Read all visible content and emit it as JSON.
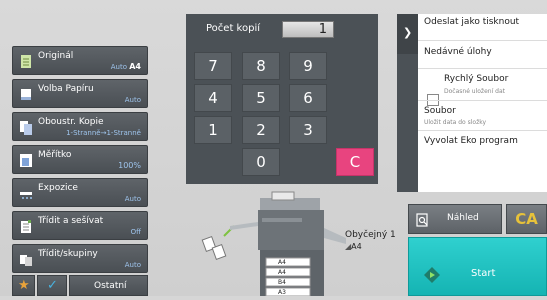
{
  "keypad": {
    "label": "Počet kopií",
    "value": "1",
    "keys": [
      "7",
      "8",
      "9",
      "4",
      "5",
      "6",
      "1",
      "2",
      "3",
      "0",
      "C"
    ]
  },
  "menu": {
    "items": [
      {
        "label": "Originál",
        "value": "Auto",
        "value2": "A4",
        "icon": "original-icon"
      },
      {
        "label": "Volba Papíru",
        "value": "Auto",
        "icon": "paper-select-icon"
      },
      {
        "label": "Oboustr. Kopie",
        "value": "1-Stranně→1-Stranně",
        "icon": "duplex-icon"
      },
      {
        "label": "Měřítko",
        "value": "100%",
        "icon": "ratio-icon"
      },
      {
        "label": "Expozice",
        "value": "Auto",
        "icon": "exposure-icon"
      },
      {
        "label": "Třídit a sešívat",
        "value": "Off",
        "icon": "sort-staple-icon"
      },
      {
        "label": "Třídit/skupiny",
        "value": "Auto",
        "icon": "sort-group-icon"
      }
    ],
    "other_label": "Ostatní"
  },
  "actions": {
    "items": [
      {
        "label": "Odeslat jako tisknout"
      },
      {
        "label": "Nedávné úlohy"
      },
      {
        "label": "Rychlý Soubor",
        "sub": "Dočasné uložení dat"
      },
      {
        "label": "Soubor",
        "sub": "Uložit data do složky"
      },
      {
        "label": "Vyvolat Eko program"
      }
    ]
  },
  "preview": {
    "label": "Náhled"
  },
  "ca": {
    "label": "CA"
  },
  "start": {
    "label": "Start"
  },
  "machine": {
    "output_paper_type": "Obyčejný 1",
    "output_paper_size": "A4",
    "trays": [
      "A4",
      "A4",
      "B4",
      "A3"
    ]
  },
  "colors": {
    "clear_key": "#e8447f",
    "start": "#1fbfbe",
    "ca_text": "#e7c23a",
    "value_text": "#9ec4ec"
  }
}
